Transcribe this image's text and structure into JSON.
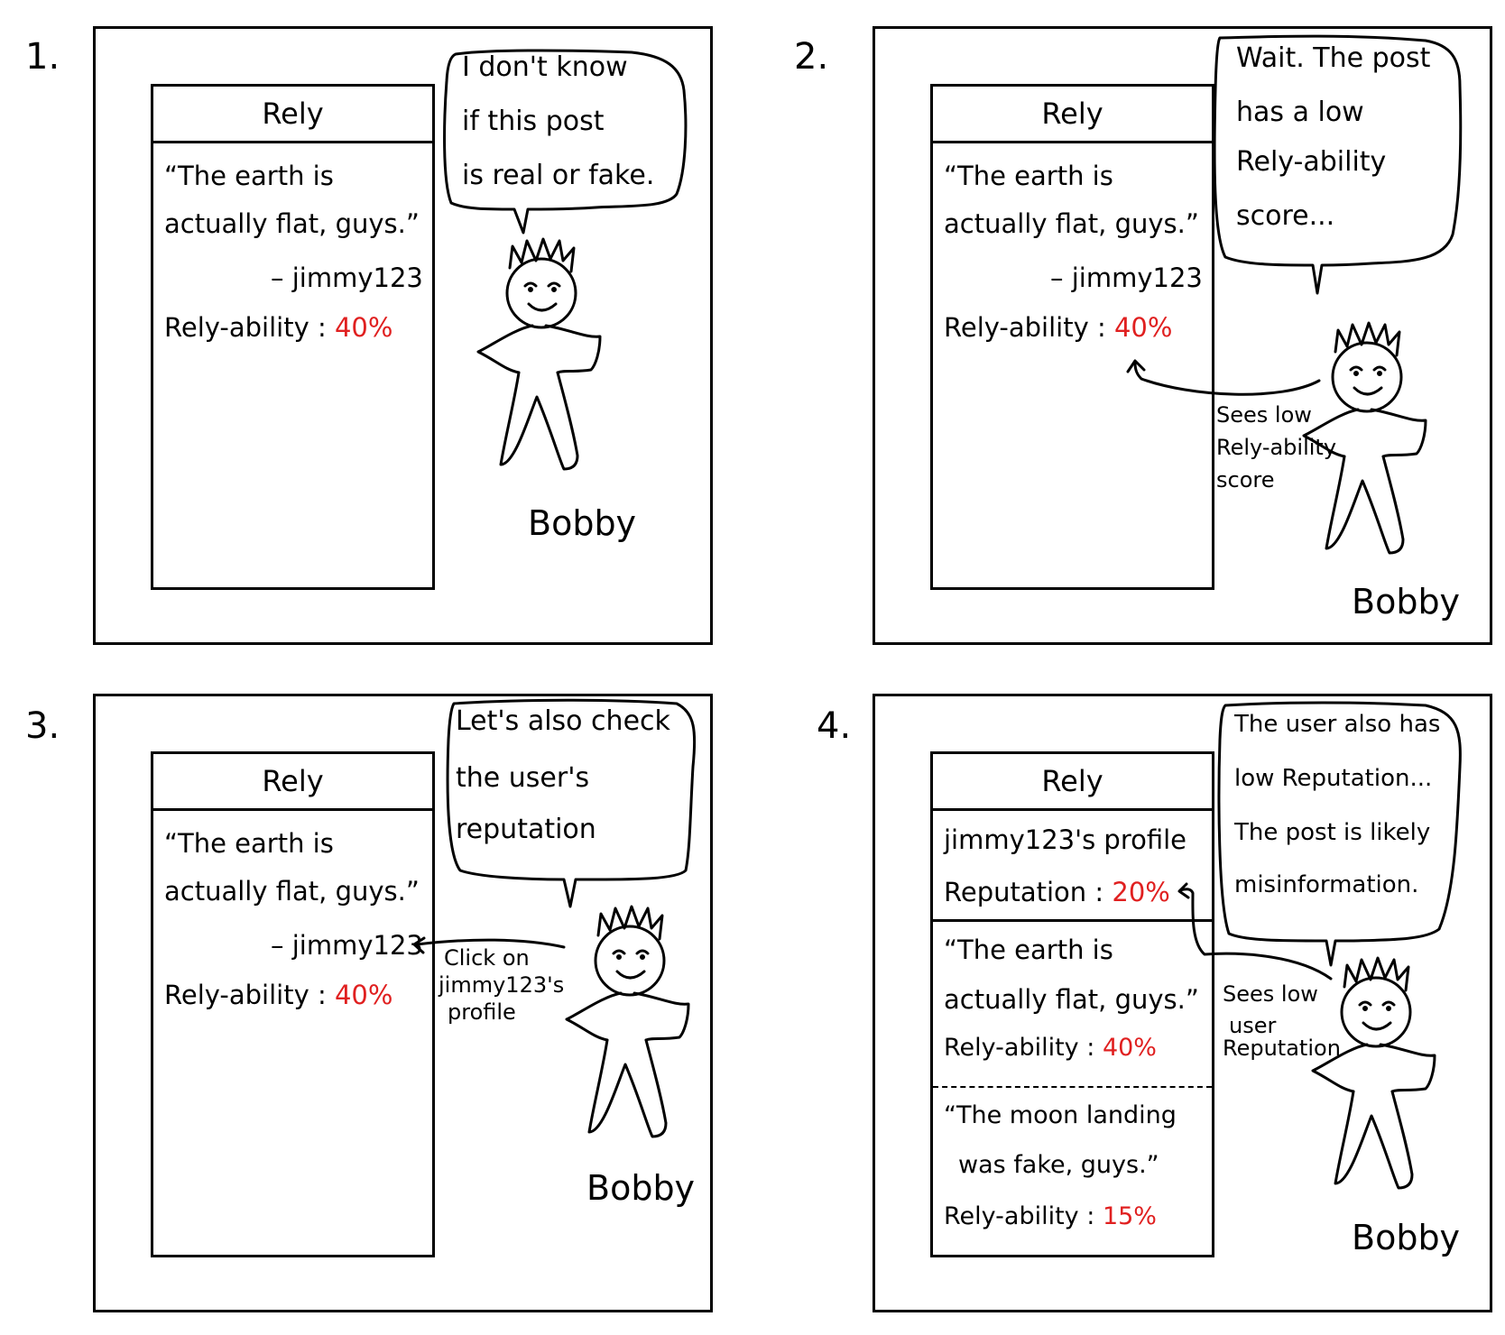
{
  "panels": [
    {
      "number": "1.",
      "app_title": "Rely",
      "post_line1": "“The earth is",
      "post_line2": "actually flat, guys.”",
      "author": "– jimmy123",
      "score_label": "Rely-ability :",
      "score_value": "40%",
      "bubble": [
        "I don't know",
        "if this post",
        "is real or fake."
      ],
      "character": "Bobby"
    },
    {
      "number": "2.",
      "app_title": "Rely",
      "post_line1": "“The earth is",
      "post_line2": "actually flat, guys.”",
      "author": "– jimmy123",
      "score_label": "Rely-ability :",
      "score_value": "40%",
      "bubble": [
        "Wait. The post",
        "has a low",
        "Rely-ability",
        "score..."
      ],
      "note": [
        "Sees low",
        "Rely-ability",
        "score"
      ],
      "character": "Bobby"
    },
    {
      "number": "3.",
      "app_title": "Rely",
      "post_line1": "“The earth is",
      "post_line2": "actually flat, guys.”",
      "author": "– jimmy123",
      "score_label": "Rely-ability :",
      "score_value": "40%",
      "bubble": [
        "Let's also check",
        "the user's",
        "reputation"
      ],
      "note": [
        "Click on",
        "jimmy123's",
        "profile"
      ],
      "character": "Bobby"
    },
    {
      "number": "4.",
      "app_title": "Rely",
      "profile_title": "jimmy123's profile",
      "reputation_label": "Reputation :",
      "reputation_value": "20%",
      "post1_line1": "“The earth is",
      "post1_line2": "actually flat, guys.”",
      "post1_score_label": "Rely-ability :",
      "post1_score_value": "40%",
      "post2_line1": "“The moon landing",
      "post2_line2": "was fake, guys.”",
      "post2_score_label": "Rely-ability :",
      "post2_score_value": "15%",
      "bubble": [
        "The user also has",
        "low Reputation...",
        "The post is likely",
        "misinformation."
      ],
      "note": [
        "Sees low",
        "user",
        "Reputation"
      ],
      "character": "Bobby"
    }
  ],
  "colors": {
    "accent": "#e02020",
    "ink": "#000000"
  }
}
